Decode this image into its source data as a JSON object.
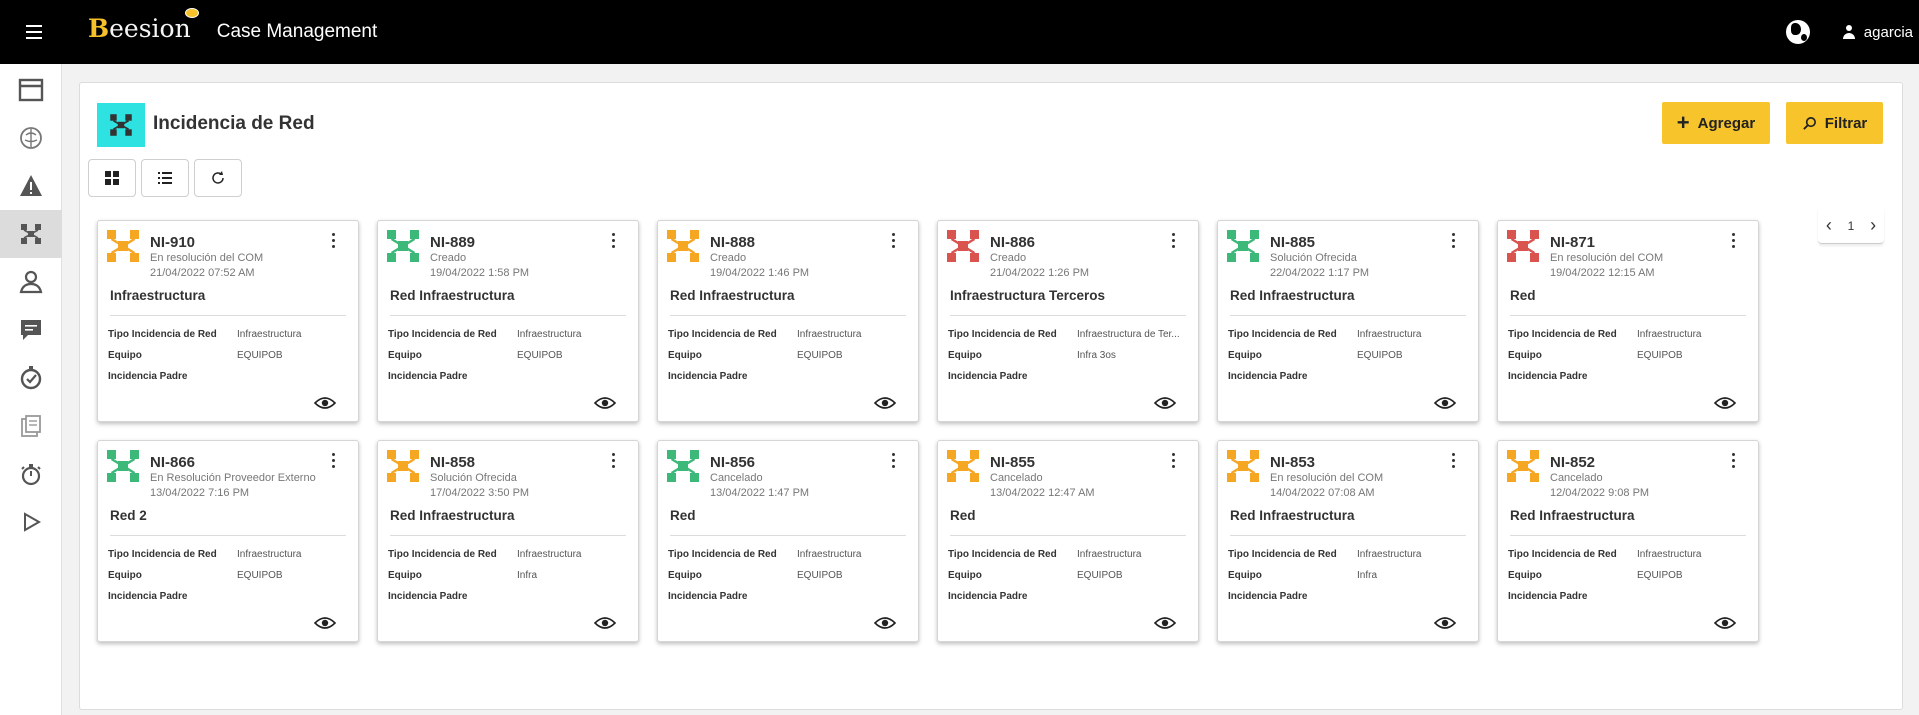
{
  "header": {
    "logo": "eesion",
    "logo_initial": "B",
    "app_title": "Case Management",
    "username": "agarcia"
  },
  "sidebar": {
    "items": [
      {
        "icon": "window-icon"
      },
      {
        "icon": "brain-icon"
      },
      {
        "icon": "warning-icon"
      },
      {
        "icon": "network-icon",
        "active": true
      },
      {
        "icon": "group-icon"
      },
      {
        "icon": "chat-icon"
      },
      {
        "icon": "timer-check-icon"
      },
      {
        "icon": "documents-icon"
      },
      {
        "icon": "stopwatch-icon"
      },
      {
        "icon": "play-icon"
      }
    ]
  },
  "page": {
    "title": "Incidencia de Red",
    "add_label": "Agregar",
    "filter_label": "Filtrar",
    "page_number": "1"
  },
  "colors": {
    "accent": "#f8c42c",
    "header_icon_bg": "#2ee2e2",
    "orange": "#f5a623",
    "green": "#3cb878",
    "red": "#d9534f"
  },
  "field_labels": {
    "tipo": "Tipo Incidencia de Red",
    "equipo": "Equipo",
    "padre": "Incidencia Padre"
  },
  "cards": [
    {
      "id": "NI-910",
      "status": "En resolución del COM",
      "date": "21/04/2022 07:52 AM",
      "title": "Infraestructura",
      "tipo": "Infraestructura",
      "equipo": "EQUIPOB",
      "padre": "",
      "color": "orange"
    },
    {
      "id": "NI-889",
      "status": "Creado",
      "date": "19/04/2022 1:58 PM",
      "title": "Red Infraestructura",
      "tipo": "Infraestructura",
      "equipo": "EQUIPOB",
      "padre": "",
      "color": "green"
    },
    {
      "id": "NI-888",
      "status": "Creado",
      "date": "19/04/2022 1:46 PM",
      "title": "Red Infraestructura",
      "tipo": "Infraestructura",
      "equipo": "EQUIPOB",
      "padre": "",
      "color": "orange"
    },
    {
      "id": "NI-886",
      "status": "Creado",
      "date": "21/04/2022 1:26 PM",
      "title": "Infraestructura Terceros",
      "tipo": "Infraestructura de Ter...",
      "equipo": "Infra 3os",
      "padre": "",
      "color": "red"
    },
    {
      "id": "NI-885",
      "status": "Solución Ofrecida",
      "date": "22/04/2022 1:17 PM",
      "title": "Red Infraestructura",
      "tipo": "Infraestructura",
      "equipo": "EQUIPOB",
      "padre": "",
      "color": "green"
    },
    {
      "id": "NI-871",
      "status": "En resolución del COM",
      "date": "19/04/2022 12:15 AM",
      "title": "Red",
      "tipo": "Infraestructura",
      "equipo": "EQUIPOB",
      "padre": "",
      "color": "red"
    },
    {
      "id": "NI-866",
      "status": "En Resolución Proveedor Externo",
      "date": "13/04/2022 7:16 PM",
      "title": "Red 2",
      "tipo": "Infraestructura",
      "equipo": "EQUIPOB",
      "padre": "",
      "color": "green"
    },
    {
      "id": "NI-858",
      "status": "Solución Ofrecida",
      "date": "17/04/2022 3:50 PM",
      "title": "Red Infraestructura",
      "tipo": "Infraestructura",
      "equipo": "Infra",
      "padre": "",
      "color": "orange"
    },
    {
      "id": "NI-856",
      "status": "Cancelado",
      "date": "13/04/2022 1:47 PM",
      "title": "Red",
      "tipo": "Infraestructura",
      "equipo": "EQUIPOB",
      "padre": "",
      "color": "green"
    },
    {
      "id": "NI-855",
      "status": "Cancelado",
      "date": "13/04/2022 12:47 AM",
      "title": "Red",
      "tipo": "Infraestructura",
      "equipo": "EQUIPOB",
      "padre": "",
      "color": "orange"
    },
    {
      "id": "NI-853",
      "status": "En resolución del COM",
      "date": "14/04/2022 07:08 AM",
      "title": "Red Infraestructura",
      "tipo": "Infraestructura",
      "equipo": "Infra",
      "padre": "",
      "color": "orange"
    },
    {
      "id": "NI-852",
      "status": "Cancelado",
      "date": "12/04/2022 9:08 PM",
      "title": "Red Infraestructura",
      "tipo": "Infraestructura",
      "equipo": "EQUIPOB",
      "padre": "",
      "color": "orange"
    }
  ]
}
